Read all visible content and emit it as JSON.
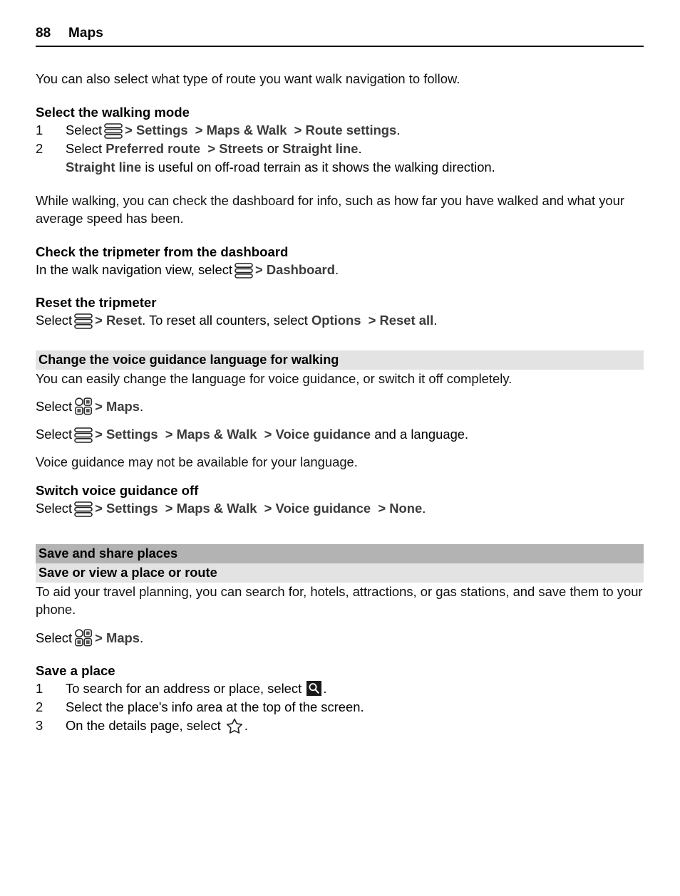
{
  "header": {
    "page_number": "88",
    "chapter": "Maps"
  },
  "icons": {
    "menu": "menu-stacked-icon",
    "grid": "app-grid-icon",
    "search": "search-icon",
    "star": "star-outline-icon"
  },
  "intro": {
    "paragraph": "You can also select what type of route you want walk navigation to follow."
  },
  "walking_mode": {
    "heading": "Select the walking mode",
    "step1": {
      "number": "1",
      "lead": "Select",
      "sep1": ">",
      "item1": "Settings",
      "sep2": ">",
      "item2": "Maps & Walk",
      "sep3": ">",
      "item3": "Route settings",
      "period": "."
    },
    "step2": {
      "number": "2",
      "lead": "Select",
      "item1": "Preferred route",
      "sep1": ">",
      "item2": "Streets",
      "conj": "or",
      "item3": "Straight line",
      "period": "."
    },
    "note": {
      "bold": "Straight line",
      "rest": "is useful on off-road terrain as it shows the walking direction."
    }
  },
  "dashboard": {
    "paragraph": "While walking, you can check the dashboard for info, such as how far you have walked and what your average speed has been.",
    "heading": "Check the tripmeter from the dashboard",
    "line_lead": "In the walk navigation view, select",
    "line_sep": ">",
    "line_item": "Dashboard",
    "line_period": "."
  },
  "reset_tripmeter": {
    "heading": "Reset the tripmeter",
    "lead": "Select",
    "sep1": ">",
    "item1": "Reset",
    "mid": ". To reset all counters, select",
    "item2": "Options",
    "sep2": ">",
    "item3": "Reset all",
    "period": "."
  },
  "voice_guidance": {
    "section_bar": "Change the voice guidance language for walking",
    "intro": "You can easily change the language for voice guidance, or switch it off completely.",
    "select_maps": {
      "lead": "Select",
      "sep": ">",
      "item": "Maps",
      "period": "."
    },
    "select_path": {
      "lead": "Select",
      "sep1": ">",
      "item1": "Settings",
      "sep2": ">",
      "item2": "Maps & Walk",
      "sep3": ">",
      "item3": "Voice guidance",
      "tail": "and a language."
    },
    "availability": "Voice guidance may not be available for your language.",
    "switch_off": {
      "heading": "Switch voice guidance off",
      "lead": "Select",
      "sep1": ">",
      "item1": "Settings",
      "sep2": ">",
      "item2": "Maps & Walk",
      "sep3": ">",
      "item3": "Voice guidance",
      "sep4": ">",
      "item4": "None",
      "period": "."
    }
  },
  "save_share": {
    "section_bar": "Save and share places",
    "sub_bar": "Save or view a place or route",
    "intro": "To aid your travel planning, you can search for, hotels, attractions, or gas stations, and save them to your phone.",
    "select_maps": {
      "lead": "Select",
      "sep": ">",
      "item": "Maps",
      "period": "."
    },
    "save_place": {
      "heading": "Save a place",
      "steps": [
        {
          "number": "1",
          "text_before": "To search for an address or place, select",
          "icon": "search-icon",
          "text_after": "."
        },
        {
          "number": "2",
          "text_before": "Select the place's info area at the top of the screen.",
          "icon": "",
          "text_after": ""
        },
        {
          "number": "3",
          "text_before": "On the details page, select",
          "icon": "star-outline-icon",
          "text_after": "."
        }
      ]
    }
  },
  "colors": {
    "section_bar_main": "#b3b3b3",
    "section_bar_sub": "#e3e3e3",
    "ui_term": "#3b3b3b",
    "text": "#111111"
  }
}
